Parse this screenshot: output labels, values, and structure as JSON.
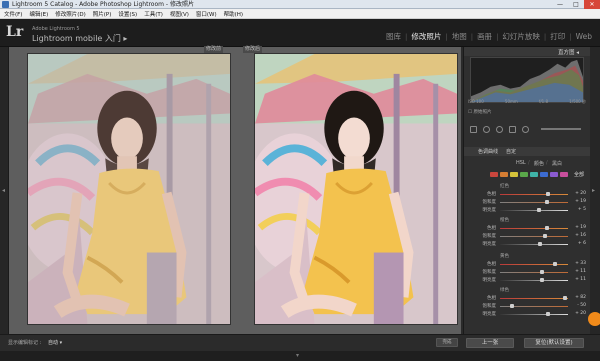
{
  "window": {
    "title": "Lightroom 5 Catalog - Adobe Photoshop Lightroom - 修改照片",
    "min": "—",
    "max": "□",
    "close": "✕"
  },
  "menu": [
    "文件(F)",
    "编辑(E)",
    "修改照片(D)",
    "照片(P)",
    "设置(S)",
    "工具(T)",
    "视图(V)",
    "窗口(W)",
    "帮助(H)"
  ],
  "identity": {
    "logo": "Lr",
    "line1": "Adobe Lightroom 5",
    "line2": "Lightroom mobile 入门 ▸"
  },
  "modules": [
    "图库",
    "修改照片",
    "地图",
    "画册",
    "幻灯片放映",
    "打印",
    "Web"
  ],
  "active_module": "修改照片",
  "view": {
    "before_label": "修改前",
    "after_label": "修改后"
  },
  "histogram": {
    "title": "直方图 ◂",
    "info": [
      "ISO 100",
      "50mm",
      "f/1.8",
      "1/500 秒"
    ],
    "original_label": "原始照片"
  },
  "basic_bar": {
    "label": "色调曲线",
    "mode": "自定"
  },
  "hsl": {
    "tabs": [
      "HSL",
      "/",
      "颜色",
      "/",
      "黑白"
    ],
    "all_label": "全部",
    "chip_colors": [
      "#c9463d",
      "#d57d33",
      "#d4c23a",
      "#5aa84a",
      "#3fb3a8",
      "#3c6bd0",
      "#8a5bd0",
      "#c84f9c"
    ],
    "groups": [
      {
        "title": "红色",
        "rows": [
          {
            "label": "色相",
            "value": "+ 20",
            "pos": 0.7
          },
          {
            "label": "饱和度",
            "value": "+ 19",
            "pos": 0.68
          },
          {
            "label": "明亮度",
            "value": "+ 5",
            "pos": 0.56
          }
        ]
      },
      {
        "title": "橙色",
        "rows": [
          {
            "label": "色相",
            "value": "+ 19",
            "pos": 0.68
          },
          {
            "label": "饱和度",
            "value": "+ 16",
            "pos": 0.65
          },
          {
            "label": "明亮度",
            "value": "+ 6",
            "pos": 0.57
          }
        ]
      },
      {
        "title": "黄色",
        "rows": [
          {
            "label": "色相",
            "value": "+ 33",
            "pos": 0.8
          },
          {
            "label": "饱和度",
            "value": "+ 11",
            "pos": 0.6
          },
          {
            "label": "明亮度",
            "value": "+ 11",
            "pos": 0.6
          }
        ]
      },
      {
        "title": "绿色",
        "rows": [
          {
            "label": "色相",
            "value": "+ 82",
            "pos": 0.95
          },
          {
            "label": "饱和度",
            "value": "- 50",
            "pos": 0.15
          },
          {
            "label": "明亮度",
            "value": "+ 20",
            "pos": 0.7
          }
        ]
      }
    ]
  },
  "bottom": {
    "left_text": "显示编辑标记 :",
    "preset": "自动 ▾",
    "small_btn": "完成",
    "prev_btn": "上一张",
    "reset_btn": "复位(默认设置)"
  }
}
